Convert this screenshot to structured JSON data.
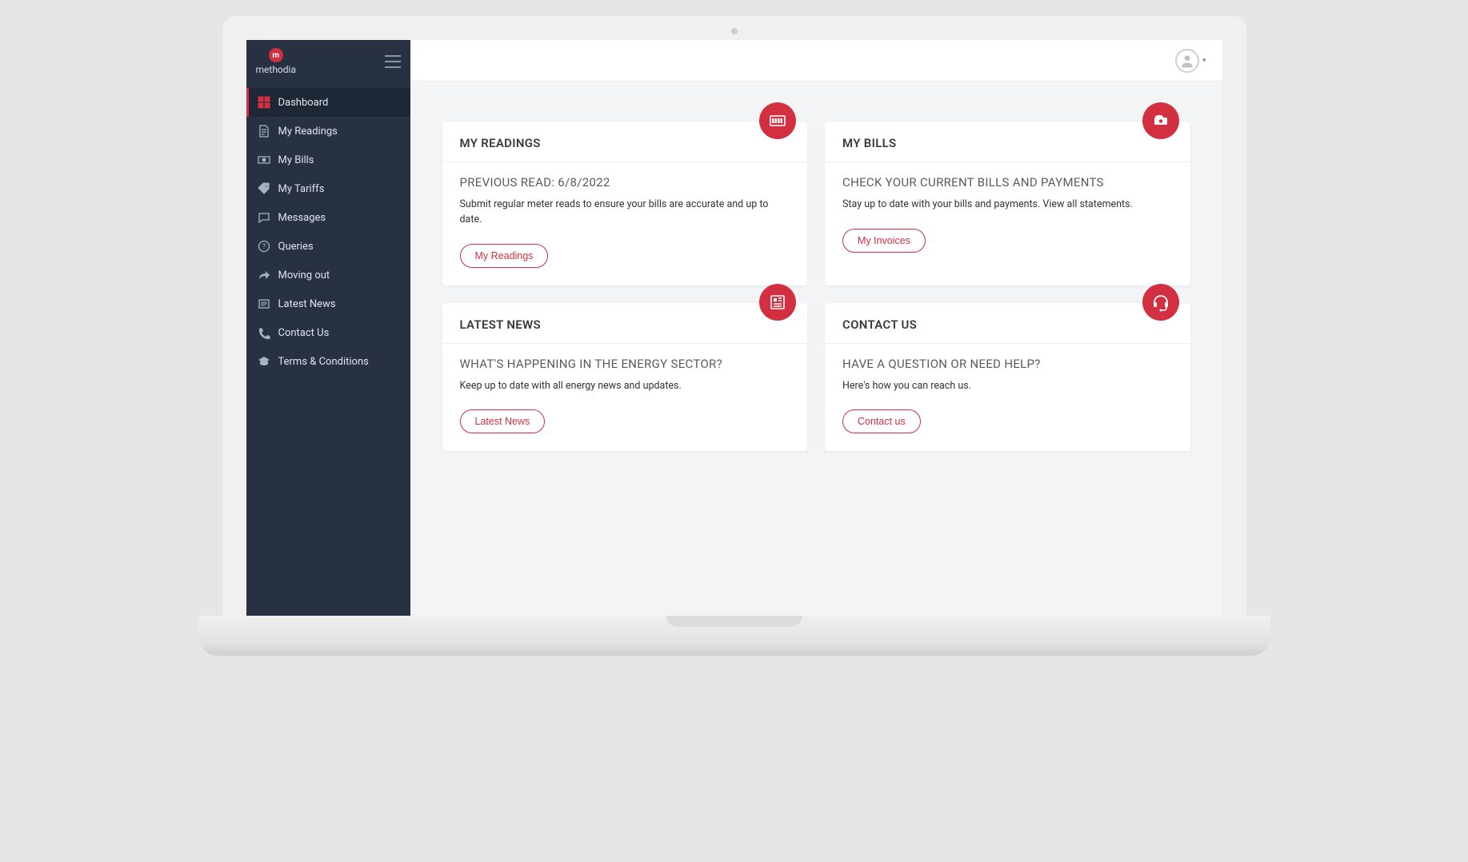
{
  "brand": {
    "logo_letter": "m",
    "name": "methodia"
  },
  "sidebar": {
    "items": [
      {
        "label": "Dashboard",
        "active": true
      },
      {
        "label": "My Readings",
        "active": false
      },
      {
        "label": "My Bills",
        "active": false
      },
      {
        "label": "My Tariffs",
        "active": false
      },
      {
        "label": "Messages",
        "active": false
      },
      {
        "label": "Queries",
        "active": false
      },
      {
        "label": "Moving out",
        "active": false
      },
      {
        "label": "Latest News",
        "active": false
      },
      {
        "label": "Contact Us",
        "active": false
      },
      {
        "label": "Terms & Conditions",
        "active": false
      }
    ]
  },
  "cards": {
    "readings": {
      "title": "MY READINGS",
      "subtitle": "PREVIOUS READ:  6/8/2022",
      "text": "Submit regular meter reads to ensure your bills are accurate and up to date.",
      "button": "My Readings"
    },
    "bills": {
      "title": "MY BILLS",
      "subtitle": "CHECK YOUR CURRENT BILLS AND PAYMENTS",
      "text": "Stay up to date with your bills and payments. View all statements.",
      "button": "My Invoices"
    },
    "news": {
      "title": "LATEST NEWS",
      "subtitle": "WHAT'S HAPPENING IN THE ENERGY SECTOR?",
      "text": "Keep up to date with all energy news and updates.",
      "button": "Latest News"
    },
    "contact": {
      "title": "CONTACT US",
      "subtitle": "HAVE A QUESTION OR NEED HELP?",
      "text": "Here's how you can reach us.",
      "button": "Contact us"
    }
  },
  "colors": {
    "accent": "#d23041",
    "sidebar": "#273142"
  }
}
